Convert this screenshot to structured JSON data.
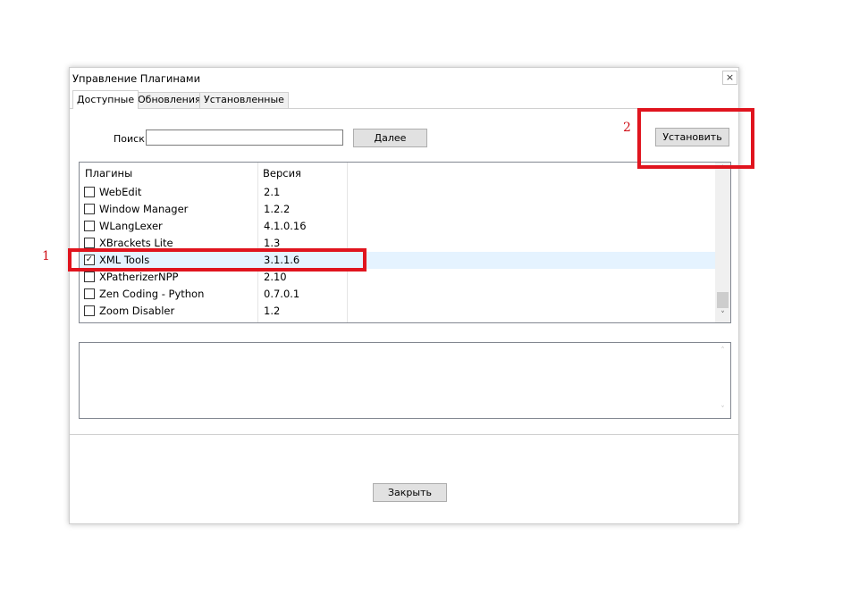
{
  "window": {
    "title": "Управление Плагинами",
    "close_glyph": "×"
  },
  "tabs": [
    {
      "label": "Доступные",
      "active": true
    },
    {
      "label": "Обновления",
      "active": false
    },
    {
      "label": "Установленные",
      "active": false
    }
  ],
  "search": {
    "label": "Поиск:",
    "value": "",
    "next_label": "Далее"
  },
  "install_label": "Установить",
  "plugin_list": {
    "headers": {
      "name": "Плагины",
      "version": "Версия"
    },
    "rows": [
      {
        "name": "WebEdit",
        "version": "2.1",
        "checked": false
      },
      {
        "name": "Window Manager",
        "version": "1.2.2",
        "checked": false
      },
      {
        "name": "WLangLexer",
        "version": "4.1.0.16",
        "checked": false
      },
      {
        "name": "XBrackets Lite",
        "version": "1.3",
        "checked": false
      },
      {
        "name": "XML Tools",
        "version": "3.1.1.6",
        "checked": true,
        "selected": true
      },
      {
        "name": "XPatherizerNPP",
        "version": "2.10",
        "checked": false
      },
      {
        "name": "Zen Coding - Python",
        "version": "0.7.0.1",
        "checked": false
      },
      {
        "name": "Zoom Disabler",
        "version": "1.2",
        "checked": false
      }
    ],
    "scroll_up_glyph": "˄",
    "scroll_down_glyph": "˅"
  },
  "close_label": "Закрыть",
  "annotations": {
    "marker_1": "1",
    "marker_2": "2",
    "highlight_color": "#e0141e"
  }
}
